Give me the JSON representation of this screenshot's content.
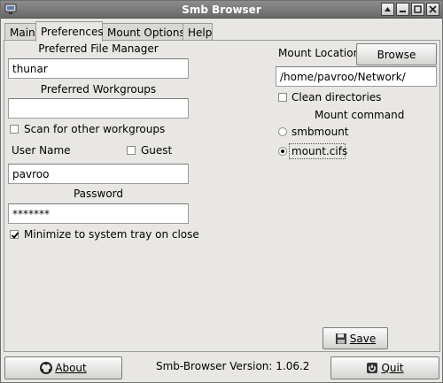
{
  "window": {
    "title": "Smb Browser"
  },
  "tabs": [
    {
      "label": "Main"
    },
    {
      "label": "Preferences"
    },
    {
      "label": "Mount Options"
    },
    {
      "label": "Help"
    }
  ],
  "preferences": {
    "file_manager_label": "Preferred File Manager",
    "file_manager_value": "thunar",
    "workgroups_label": "Preferred Workgroups",
    "workgroups_value": "",
    "scan_workgroups_label": "Scan for other workgroups",
    "scan_workgroups_checked": false,
    "user_name_label": "User Name",
    "guest_label": "Guest",
    "guest_checked": false,
    "user_name_value": "pavroo",
    "password_label": "Password",
    "password_value": "*******",
    "minimize_tray_label": "Minimize to system tray on close",
    "minimize_tray_checked": true,
    "mount_location_label": "Mount Location",
    "browse_label": "Browse",
    "mount_location_value": "/home/pavroo/Network/",
    "clean_dirs_label": "Clean directories",
    "clean_dirs_checked": false,
    "mount_command_label": "Mount command",
    "mount_options": [
      {
        "label": "smbmount",
        "selected": false
      },
      {
        "label": "mount.cifs",
        "selected": true
      }
    ],
    "save_label": "Save"
  },
  "footer": {
    "about_label": "About",
    "version_text": "Smb-Browser Version: 1.06.2",
    "quit_label": "Quit"
  },
  "icons": {
    "window": "smb-network-icon",
    "about": "about-icon",
    "save": "floppy-disk-icon",
    "quit": "quit-icon"
  }
}
